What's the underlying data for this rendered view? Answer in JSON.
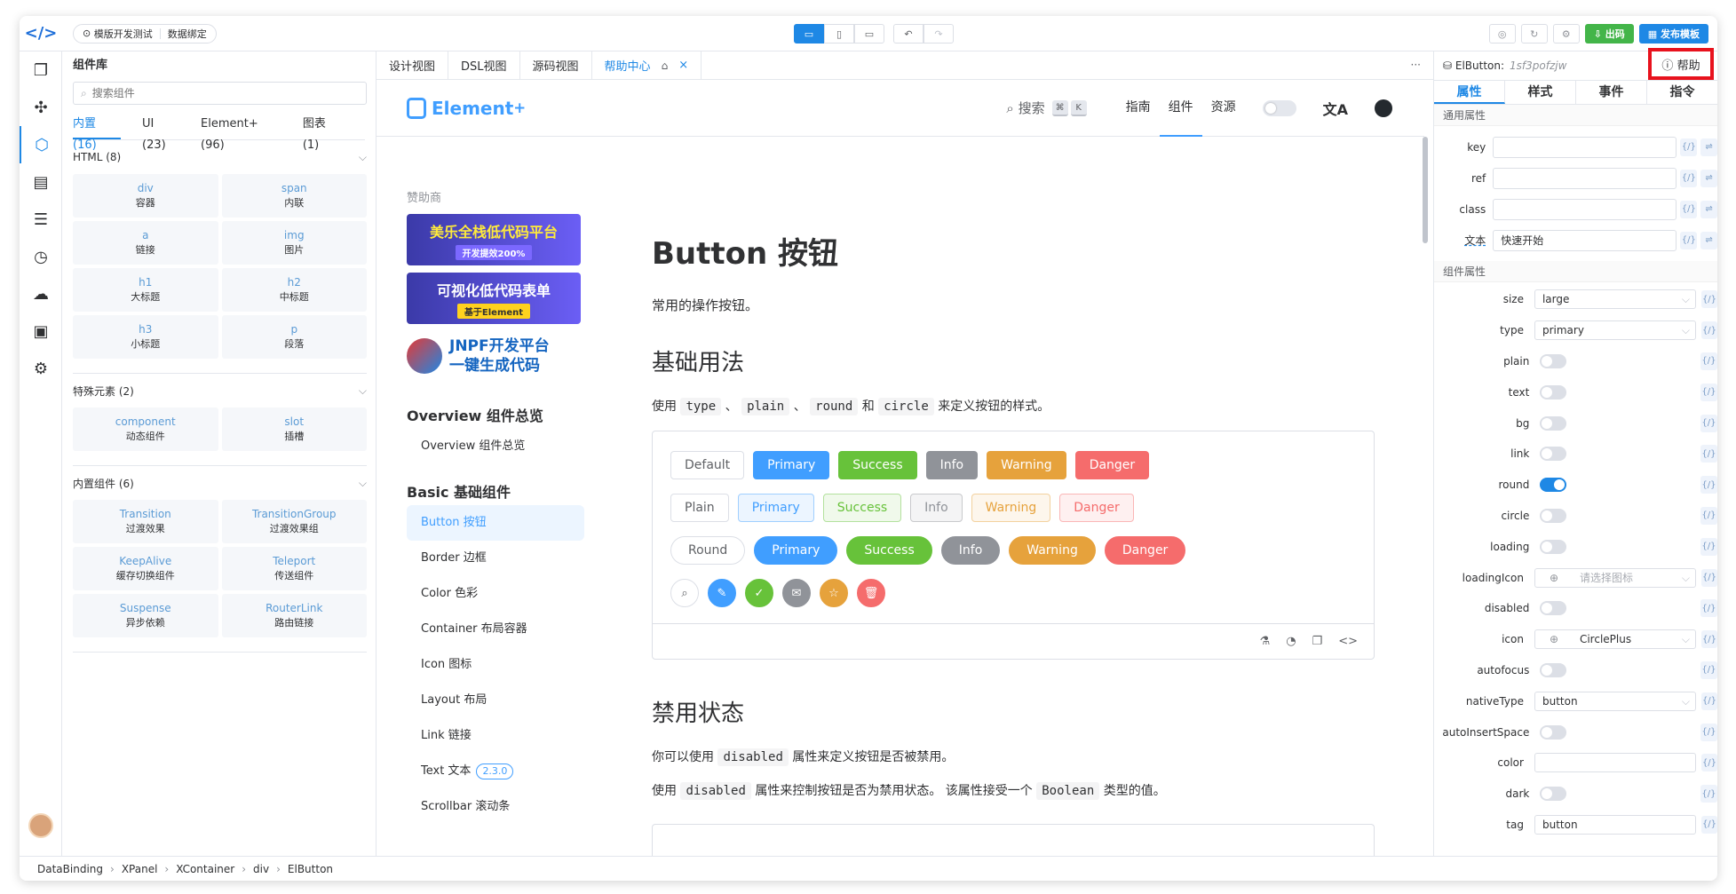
{
  "toolbar": {
    "logo": "</>",
    "project_name": "模版开发测试",
    "data_binding": "数据绑定",
    "export_label": "出码",
    "publish_label": "发布模板"
  },
  "rail": {
    "items": [
      "pages-icon",
      "plugin-icon",
      "cube-icon",
      "layout-icon",
      "tree-icon",
      "history-icon",
      "cloud-icon",
      "apps-icon",
      "settings-icon"
    ],
    "active_index": 2
  },
  "library": {
    "title": "组件库",
    "search_placeholder": "搜索组件",
    "tabs": [
      "内置 (16)",
      "UI (23)",
      "Element+ (96)",
      "图表 (1)"
    ],
    "groups": [
      {
        "title": "HTML (8)",
        "items": [
          {
            "en": "div",
            "zh": "容器"
          },
          {
            "en": "span",
            "zh": "内联"
          },
          {
            "en": "a",
            "zh": "链接"
          },
          {
            "en": "img",
            "zh": "图片"
          },
          {
            "en": "h1",
            "zh": "大标题"
          },
          {
            "en": "h2",
            "zh": "中标题"
          },
          {
            "en": "h3",
            "zh": "小标题"
          },
          {
            "en": "p",
            "zh": "段落"
          }
        ]
      },
      {
        "title": "特殊元素 (2)",
        "items": [
          {
            "en": "component",
            "zh": "动态组件"
          },
          {
            "en": "slot",
            "zh": "插槽"
          }
        ]
      },
      {
        "title": "内置组件 (6)",
        "items": [
          {
            "en": "Transition",
            "zh": "过渡效果"
          },
          {
            "en": "TransitionGroup",
            "zh": "过渡效果组"
          },
          {
            "en": "KeepAlive",
            "zh": "缓存切换组件"
          },
          {
            "en": "Teleport",
            "zh": "传送组件"
          },
          {
            "en": "Suspense",
            "zh": "异步依赖"
          },
          {
            "en": "RouterLink",
            "zh": "路由链接"
          }
        ]
      }
    ]
  },
  "center": {
    "tabs": [
      "设计视图",
      "DSL视图",
      "源码视图",
      "帮助中心"
    ],
    "more": "···"
  },
  "doc": {
    "brand": "Element",
    "brand_sup": "+",
    "search": "搜索",
    "kbd": [
      "⌘",
      "K"
    ],
    "nav": [
      "指南",
      "组件",
      "资源"
    ],
    "translate_icon": "文A",
    "sponsor_label": "赞助商",
    "banner1": "美乐全栈低代码平台",
    "banner1_sub": "开发提效200%",
    "banner2": "可视化低代码表单",
    "banner2_sub": "基于Element",
    "banner3_line1": "JNPF开发平台",
    "banner3_line2": "一键生成代码",
    "side_h1": "Overview 组件总览",
    "side_overview": "Overview 组件总览",
    "side_h2": "Basic 基础组件",
    "side_items": [
      "Button 按钮",
      "Border 边框",
      "Color 色彩",
      "Container 布局容器",
      "Icon 图标",
      "Layout 布局",
      "Link 链接",
      "Text 文本",
      "Scrollbar 滚动条"
    ],
    "text_version": "2.3.0",
    "title": "Button 按钮",
    "intro": "常用的操作按钮。",
    "h_basic": "基础用法",
    "basic_desc_pre": "使用",
    "basic_codes": [
      "type",
      "plain",
      "round",
      "circle"
    ],
    "basic_sep1": "、",
    "basic_and": "和",
    "basic_desc_post": "来定义按钮的样式。",
    "row_default": [
      "Default",
      "Primary",
      "Success",
      "Info",
      "Warning",
      "Danger"
    ],
    "row_plain": [
      "Plain",
      "Primary",
      "Success",
      "Info",
      "Warning",
      "Danger"
    ],
    "row_round": [
      "Round",
      "Primary",
      "Success",
      "Info",
      "Warning",
      "Danger"
    ],
    "circle_icons": [
      "search-icon",
      "edit-icon",
      "check-icon",
      "message-icon",
      "star-icon",
      "delete-icon"
    ],
    "h_disabled": "禁用状态",
    "disabled_p1_pre": "你可以使用",
    "disabled_code": "disabled",
    "disabled_p1_post": "属性来定义按钮是否被禁用。",
    "disabled_p2_pre": "使用",
    "disabled_p2_mid": "属性来控制按钮是否为禁用状态。 该属性接受一个",
    "boolean_code": "Boolean",
    "disabled_p2_post": "类型的值。",
    "colors": {
      "primary": "#409eff",
      "success": "#67c23a",
      "info": "#909399",
      "warning": "#e6a23c",
      "danger": "#f56c6c"
    }
  },
  "props": {
    "component": "ElButton:",
    "component_id": "1sf3pofzjw",
    "help": "帮助",
    "tabs": [
      "属性",
      "样式",
      "事件",
      "指令"
    ],
    "common_title": "通用属性",
    "common": [
      {
        "label": "key",
        "value": ""
      },
      {
        "label": "ref",
        "value": ""
      },
      {
        "label": "class",
        "value": ""
      },
      {
        "label": "文本",
        "value": "快速开始"
      }
    ],
    "comp_title": "组件属性",
    "comp": [
      {
        "label": "size",
        "kind": "select",
        "value": "large"
      },
      {
        "label": "type",
        "kind": "select",
        "value": "primary"
      },
      {
        "label": "plain",
        "kind": "switch",
        "on": false
      },
      {
        "label": "text",
        "kind": "switch",
        "on": false
      },
      {
        "label": "bg",
        "kind": "switch",
        "on": false
      },
      {
        "label": "link",
        "kind": "switch",
        "on": false
      },
      {
        "label": "round",
        "kind": "switch",
        "on": true
      },
      {
        "label": "circle",
        "kind": "switch",
        "on": false
      },
      {
        "label": "loading",
        "kind": "switch",
        "on": false
      },
      {
        "label": "loadingIcon",
        "kind": "icon-select",
        "value": "请选择图标"
      },
      {
        "label": "disabled",
        "kind": "switch",
        "on": false
      },
      {
        "label": "icon",
        "kind": "icon-select",
        "value": "CirclePlus"
      },
      {
        "label": "autofocus",
        "kind": "switch",
        "on": false
      },
      {
        "label": "nativeType",
        "kind": "select",
        "value": "button"
      },
      {
        "label": "autoInsertSpace",
        "kind": "switch",
        "on": false
      },
      {
        "label": "color",
        "kind": "input",
        "value": ""
      },
      {
        "label": "dark",
        "kind": "switch",
        "on": false
      },
      {
        "label": "tag",
        "kind": "input",
        "value": "button"
      }
    ]
  },
  "statusbar": {
    "crumbs": [
      "DataBinding",
      "XPanel",
      "XContainer",
      "div",
      "ElButton"
    ]
  }
}
